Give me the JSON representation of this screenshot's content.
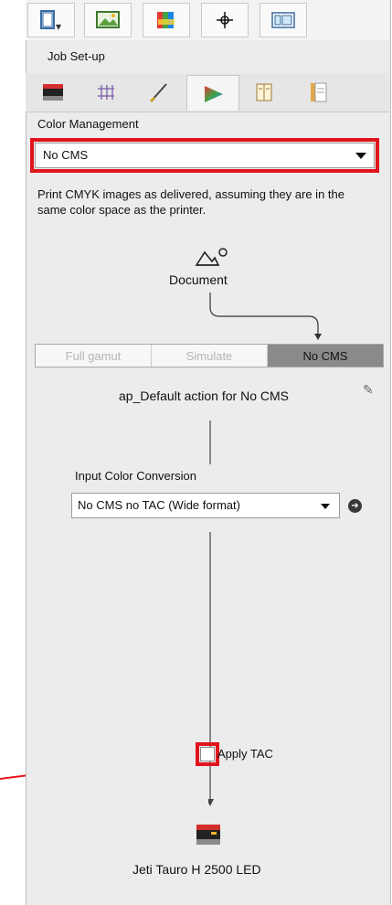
{
  "toolbar": {
    "icons": [
      "book-icon",
      "image-icon",
      "color-swatches-icon",
      "crosshair-icon",
      "layout-icon"
    ]
  },
  "panel": {
    "header": "Job Set-up",
    "tabs": [
      "printer-icon",
      "grid-icon",
      "brush-icon",
      "color-triangle-icon",
      "book-pages-icon",
      "document-icon"
    ],
    "active_tab_index": 3
  },
  "color_management": {
    "label": "Color Management",
    "selected": "No CMS",
    "description": "Print CMYK images as delivered, assuming they are in the same color space as the printer."
  },
  "flow": {
    "source_label": "Document",
    "modes": [
      "Full gamut",
      "Simulate",
      "No CMS"
    ],
    "active_mode": "No CMS",
    "action_title": "ap_Default action for No CMS",
    "input_conversion_label": "Input Color Conversion",
    "input_conversion_selected": "No CMS no TAC (Wide format)",
    "apply_tac_label": "Apply TAC",
    "apply_tac_checked": false,
    "printer_label": "Jeti Tauro H 2500 LED"
  },
  "annotation_color": "#e0151b"
}
